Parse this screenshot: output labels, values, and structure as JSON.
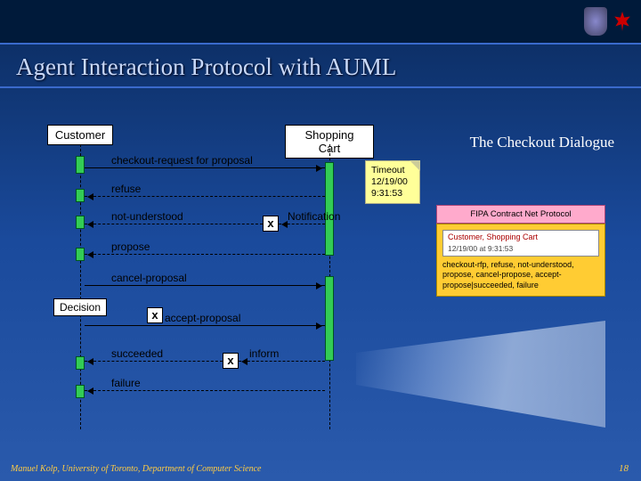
{
  "header": {
    "title": "Agent Interaction Protocol with AUML"
  },
  "subtitle": "The Checkout Dialogue",
  "lifelines": {
    "customer": "Customer",
    "cart": "Shopping Cart"
  },
  "messages": {
    "m1": "checkout-request for proposal",
    "m2": "refuse",
    "m3": "not-understood",
    "m3b": "Notification",
    "m4": "propose",
    "m5": "cancel-proposal",
    "m6": "accept-proposal",
    "m7": "succeeded",
    "m7b": "inform",
    "m8": "failure",
    "decision": "Decision"
  },
  "note": {
    "l1": "Timeout",
    "l2": "12/19/00",
    "l3": "9:31:53"
  },
  "info": {
    "head": "FIPA Contract Net Protocol",
    "roles": "Customer, Shopping Cart",
    "dt": "12/19/00 at 9:31:53",
    "body": "checkout-rfp, refuse, not-understood, propose, cancel-propose, accept-propose|succeeded, failure"
  },
  "footer": {
    "left": "Manuel Kolp, University of Toronto, Department of Computer Science",
    "right": "18"
  }
}
